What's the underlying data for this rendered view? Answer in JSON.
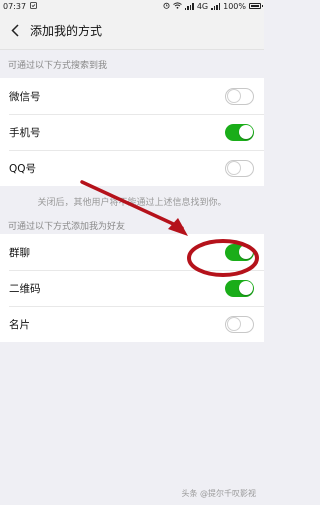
{
  "status_bar": {
    "time": "07:37",
    "network": "4G",
    "battery": "100%"
  },
  "nav": {
    "title": "添加我的方式"
  },
  "search_section": {
    "header": "可通过以下方式搜索到我",
    "items": [
      {
        "label": "微信号",
        "enabled": false
      },
      {
        "label": "手机号",
        "enabled": true
      },
      {
        "label": "QQ号",
        "enabled": false
      }
    ],
    "footnote": "关闭后，其他用户将不能通过上述信息找到你。"
  },
  "add_section": {
    "header": "可通过以下方式添加我为好友",
    "items": [
      {
        "label": "群聊",
        "enabled": true
      },
      {
        "label": "二维码",
        "enabled": true
      },
      {
        "label": "名片",
        "enabled": false
      }
    ]
  },
  "watermark": "头条 @提尔千叹影视",
  "colors": {
    "toggle_on": "#1aad19",
    "annotation": "#b5121b",
    "background": "#efeff4"
  }
}
